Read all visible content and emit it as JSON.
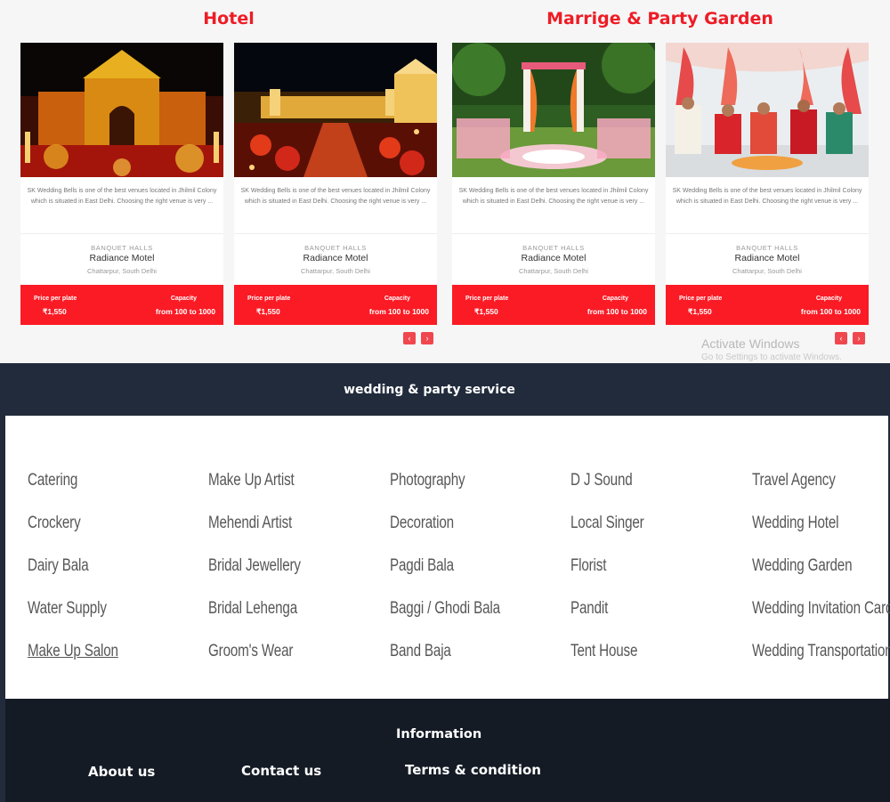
{
  "sections": {
    "hotel_title": "Hotel",
    "garden_title": "Marrige & Party Garden"
  },
  "cards": [
    {
      "image": "palace-lit-night-photo",
      "description": "SK Wedding Bells is one of the best venues located in Jhilmil Colony which is situated in East Delhi. Choosing the right venue is very ...",
      "category": "BANQUET HALLS",
      "name": "Radiance Motel",
      "location": "Chattarpur, South Delhi",
      "price_label": "Price per plate",
      "price": "₹1,550",
      "capacity_label": "Capacity",
      "capacity": "from 100 to 1000"
    },
    {
      "image": "palace-courtyard-dining-photo",
      "description": "SK Wedding Bells is one of the best venues located in Jhilmil Colony which is situated in East Delhi. Choosing the right venue is very ...",
      "category": "BANQUET HALLS",
      "name": "Radiance Motel",
      "location": "Chattarpur, South Delhi",
      "price_label": "Price per plate",
      "price": "₹1,550",
      "capacity_label": "Capacity",
      "capacity": "from 100 to 1000"
    },
    {
      "image": "garden-mandap-photo",
      "description": "SK Wedding Bells is one of the best venues located in Jhilmil Colony which is situated in East Delhi. Choosing the right venue is very ...",
      "category": "BANQUET HALLS",
      "name": "Radiance Motel",
      "location": "Chattarpur, South Delhi",
      "price_label": "Price per plate",
      "price": "₹1,550",
      "capacity_label": "Capacity",
      "capacity": "from 100 to 1000"
    },
    {
      "image": "wedding-ceremony-photo",
      "description": "SK Wedding Bells is one of the best venues located in Jhilmil Colony which is situated in East Delhi. Choosing the right venue is very ...",
      "category": "BANQUET HALLS",
      "name": "Radiance Motel",
      "location": "Chattarpur, South Delhi",
      "price_label": "Price per plate",
      "price": "₹1,550",
      "capacity_label": "Capacity",
      "capacity": "from 100 to 1000"
    }
  ],
  "carousel_nav": {
    "prev": "‹",
    "next": "›"
  },
  "watermark": {
    "title": "Activate Windows",
    "subtitle": "Go to Settings to activate Windows."
  },
  "services": {
    "title": "wedding & party service",
    "columns": [
      [
        "Catering",
        "Crockery",
        "Dairy Bala",
        "Water Supply",
        "Make Up Salon"
      ],
      [
        "Make Up Artist",
        "Mehendi Artist",
        "Bridal Jewellery",
        "Bridal Lehenga",
        "Groom's Wear"
      ],
      [
        "Photography",
        "Decoration",
        "Pagdi Bala",
        "Baggi / Ghodi Bala",
        "Band Baja"
      ],
      [
        "D J Sound",
        "Local Singer",
        "Florist",
        "Pandit",
        "Tent House"
      ],
      [
        "Travel Agency",
        "Wedding Hotel",
        "Wedding Garden",
        "Wedding Invitation Card",
        "Wedding Transportation"
      ]
    ]
  },
  "footer": {
    "title": "Information",
    "links": {
      "about": "About us",
      "contact": "Contact us",
      "terms": "Terms & condition"
    }
  },
  "colors": {
    "accent_red": "#fb1b25",
    "title_red": "#ee1c25",
    "nav_button": "#f0474f",
    "services_band": "#212b3b",
    "footer_bg": "#141b25"
  }
}
